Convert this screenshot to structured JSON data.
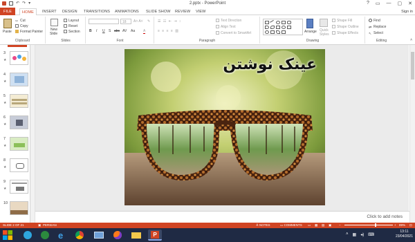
{
  "window": {
    "title": "2.pptx - PowerPoint",
    "controls": [
      "?",
      "▭",
      "—",
      "▢",
      "✕"
    ],
    "sign_in": "Sign in"
  },
  "tabs": [
    "FILE",
    "HOME",
    "INSERT",
    "DESIGN",
    "TRANSITIONS",
    "ANIMATIONS",
    "SLIDE SHOW",
    "REVIEW",
    "VIEW"
  ],
  "ribbon": {
    "clipboard": {
      "paste": "Paste",
      "cut": "Cut",
      "copy": "Copy",
      "format_painter": "Format Painter",
      "label": "Clipboard"
    },
    "slides": {
      "new_slide": "New",
      "new_slide2": "Slide",
      "layout": "Layout",
      "reset": "Reset",
      "section": "Section",
      "label": "Slides"
    },
    "font": {
      "size": "18",
      "label": "Font",
      "buttons": [
        "B",
        "I",
        "U",
        "S",
        "abc",
        "AV",
        "Aa",
        "A"
      ]
    },
    "paragraph": {
      "text_direction": "Text Direction",
      "align_text": "Align Text",
      "convert_smartart": "Convert to SmartArt",
      "label": "Paragraph"
    },
    "drawing": {
      "arrange": "Arrange",
      "quick_styles": "Quick",
      "quick_styles2": "Styles",
      "shape_fill": "Shape Fill",
      "shape_outline": "Shape Outline",
      "shape_effects": "Shape Effects",
      "label": "Drawing"
    },
    "editing": {
      "find": "Find",
      "replace": "Replace",
      "select": "Select",
      "label": "Editing"
    }
  },
  "thumbnails": [
    {
      "num": "3",
      "star": "★"
    },
    {
      "num": "4",
      "star": "★"
    },
    {
      "num": "5",
      "star": "★"
    },
    {
      "num": "6",
      "star": "★"
    },
    {
      "num": "7",
      "star": "★"
    },
    {
      "num": "8",
      "star": "★"
    },
    {
      "num": "9",
      "star": "★"
    },
    {
      "num": "10",
      "star": ""
    }
  ],
  "slide": {
    "title": "عینک نوشتن"
  },
  "notes_placeholder": "Click to add notes",
  "status": {
    "slide": "SLIDE 2 OF 21",
    "language": "PERSIAN",
    "notes": "NOTES",
    "comments": "COMMENTS",
    "zoom": "89%"
  },
  "taskbar": {
    "time": "13:11",
    "date": "23/04/2021"
  },
  "colors": {
    "accent": "#d04423",
    "taskbar": "#1f2a44"
  }
}
